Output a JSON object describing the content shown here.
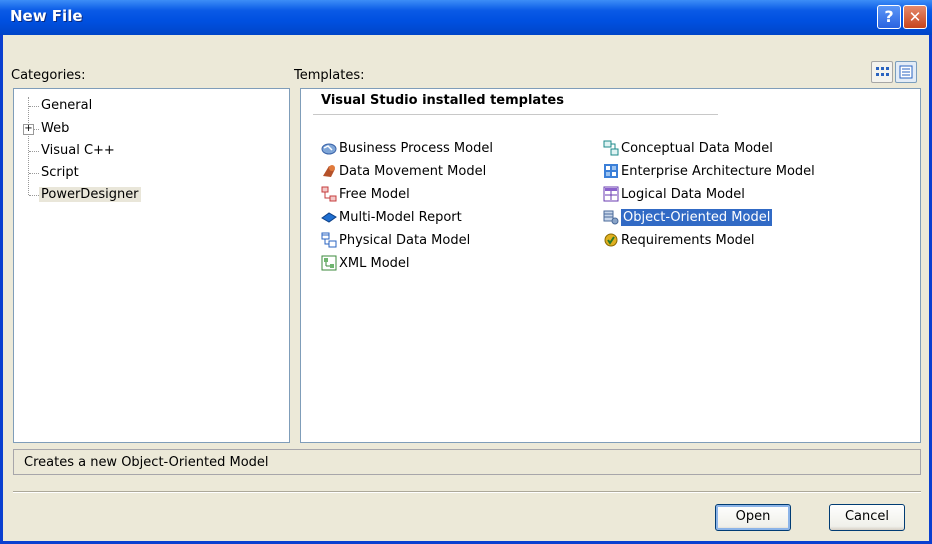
{
  "window": {
    "title": "New File"
  },
  "titlebar_buttons": {
    "help": "?",
    "close": "✕"
  },
  "categories": {
    "label": "Categories:",
    "items": [
      {
        "label": "General"
      },
      {
        "label": "Web",
        "expander": "+"
      },
      {
        "label": "Visual C++"
      },
      {
        "label": "Script"
      },
      {
        "label": "PowerDesigner",
        "selected": true
      }
    ]
  },
  "templates": {
    "label": "Templates:",
    "section_header": "Visual Studio installed templates",
    "left_column": [
      {
        "label": "Business Process Model",
        "icon": "business-process-icon"
      },
      {
        "label": "Data Movement Model",
        "icon": "data-movement-icon"
      },
      {
        "label": "Free Model",
        "icon": "free-model-icon"
      },
      {
        "label": "Multi-Model Report",
        "icon": "report-icon"
      },
      {
        "label": "Physical Data Model",
        "icon": "physical-data-icon"
      },
      {
        "label": "XML Model",
        "icon": "xml-icon"
      }
    ],
    "right_column": [
      {
        "label": "Conceptual Data Model",
        "icon": "conceptual-data-icon"
      },
      {
        "label": "Enterprise Architecture Model",
        "icon": "enterprise-architecture-icon"
      },
      {
        "label": "Logical Data Model",
        "icon": "logical-data-icon"
      },
      {
        "label": "Object-Oriented Model",
        "icon": "object-oriented-icon",
        "selected": true
      },
      {
        "label": "Requirements Model",
        "icon": "requirements-icon"
      }
    ]
  },
  "view_buttons": [
    {
      "name": "large-icons-view",
      "active": false
    },
    {
      "name": "small-icons-view",
      "active": true
    }
  ],
  "description": "Creates a new Object-Oriented Model",
  "buttons": {
    "open": "Open",
    "cancel": "Cancel"
  },
  "colors": {
    "title_bar": "#0050e0",
    "selection": "#316ac5",
    "dialog_bg": "#ece9d8"
  }
}
